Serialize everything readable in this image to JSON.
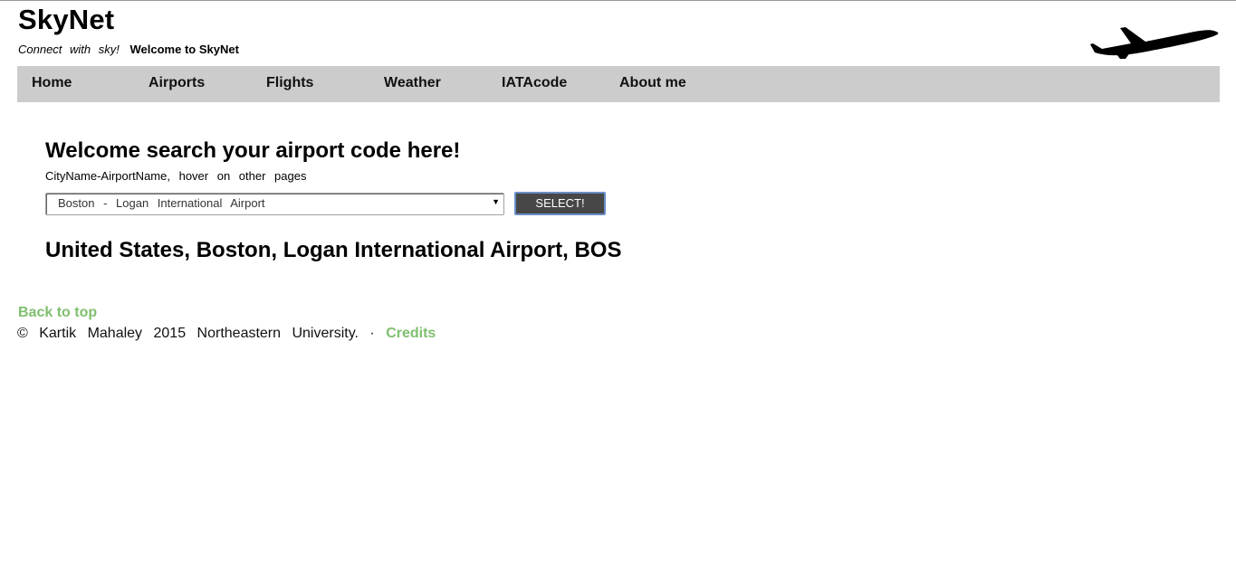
{
  "header": {
    "brand": "SkyNet",
    "slogan": "Connect with sky!",
    "welcome": "Welcome to SkyNet",
    "logo_icon": "airplane-icon"
  },
  "nav": {
    "items": [
      {
        "label": "Home"
      },
      {
        "label": "Airports"
      },
      {
        "label": "Flights"
      },
      {
        "label": "Weather"
      },
      {
        "label": "IATAcode"
      },
      {
        "label": "About me"
      }
    ]
  },
  "main": {
    "heading": "Welcome search your airport code here!",
    "hint": "CityName-AirportName, hover on other pages",
    "airport_select": {
      "selected": "Boston - Logan International Airport"
    },
    "select_button": "SELECT!",
    "result": "United States, Boston, Logan International Airport, BOS"
  },
  "footer": {
    "back_to_top": "Back to top",
    "copyright": "© Kartik Mahaley 2015 Northeastern University. ·",
    "credits": "Credits"
  },
  "colors": {
    "nav_bg": "#cccccc",
    "link_green": "#7fbf6e",
    "button_bg": "#474747",
    "button_border": "#6a8fc9"
  }
}
